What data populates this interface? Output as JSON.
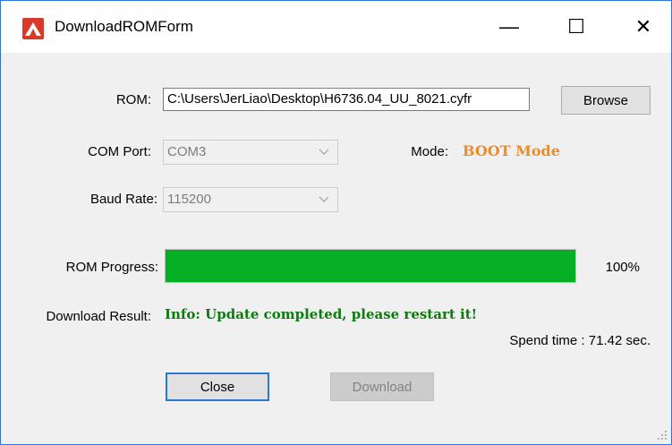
{
  "window": {
    "title": "DownloadROMForm"
  },
  "titlebar": {
    "minimize": "—",
    "maximize": "☐",
    "close": "✕"
  },
  "rom": {
    "label": "ROM:",
    "path": "C:\\Users\\JerLiao\\Desktop\\H6736.04_UU_8021.cyfr",
    "browse_label": "Browse"
  },
  "com_port": {
    "label": "COM Port:",
    "value": "COM3"
  },
  "mode": {
    "label": "Mode:",
    "value": "BOOT Mode",
    "color": "#f08a24"
  },
  "baud_rate": {
    "label": "Baud Rate:",
    "value": "115200"
  },
  "progress": {
    "label": "ROM Progress:",
    "value": 100,
    "percent_text": "100%",
    "color": "#06b025"
  },
  "result": {
    "label": "Download Result:",
    "message": "Info: Update completed, please restart it!",
    "color": "#0b7d0b"
  },
  "spend_time": "Spend time : 71.42 sec.",
  "buttons": {
    "close_label": "Close",
    "download_label": "Download"
  }
}
